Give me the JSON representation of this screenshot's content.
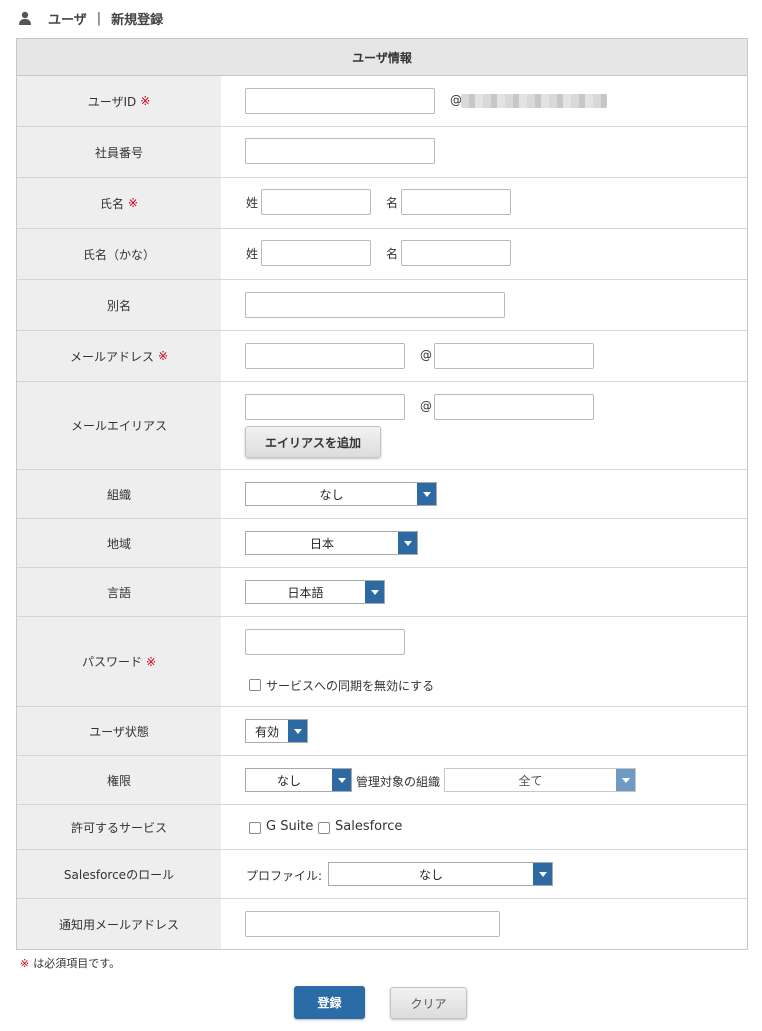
{
  "header": {
    "section": "ユーザ",
    "separator": "|",
    "title": "新規登録"
  },
  "table_title": "ユーザ情報",
  "required_mark": "※",
  "fields": {
    "user_id": {
      "label": "ユーザID",
      "at": "@"
    },
    "employee_no": {
      "label": "社員番号"
    },
    "name": {
      "label": "氏名",
      "last": "姓",
      "first": "名"
    },
    "name_kana": {
      "label": "氏名（かな）",
      "last": "姓",
      "first": "名"
    },
    "alias": {
      "label": "別名"
    },
    "email": {
      "label": "メールアドレス",
      "at": "@"
    },
    "email_alias": {
      "label": "メールエイリアス",
      "at": "@",
      "add_button": "エイリアスを追加"
    },
    "org": {
      "label": "組織",
      "value": "なし"
    },
    "region": {
      "label": "地域",
      "value": "日本"
    },
    "language": {
      "label": "言語",
      "value": "日本語"
    },
    "password": {
      "label": "パスワード",
      "disable_sync": "サービスへの同期を無効にする"
    },
    "status": {
      "label": "ユーザ状態",
      "value": "有効"
    },
    "role": {
      "label": "権限",
      "value": "なし",
      "managed_org_label": "管理対象の組織",
      "managed_org_value": "全て"
    },
    "services": {
      "label": "許可するサービス",
      "options": [
        "G Suite",
        "Salesforce"
      ]
    },
    "sf_role": {
      "label": "Salesforceのロール",
      "profile_label": "プロファイル:",
      "profile_value": "なし"
    },
    "notify_email": {
      "label": "通知用メールアドレス"
    }
  },
  "note": "は必須項目です。",
  "buttons": {
    "submit": "登録",
    "clear": "クリア"
  },
  "colors": {
    "primary": "#2b6ba6",
    "required": "#d0021b",
    "label_bg": "#eeeeee",
    "header_bg": "#e6e6e6"
  }
}
